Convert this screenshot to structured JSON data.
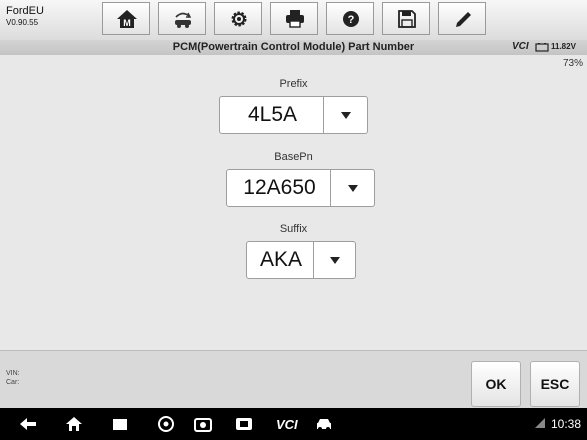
{
  "app": {
    "name": "FordEU",
    "version": "V0.90.55"
  },
  "toolbar": {
    "icons": [
      "home-icon",
      "vehicle-swap-icon",
      "settings-icon",
      "print-icon",
      "help-icon",
      "save-icon",
      "edit-icon"
    ]
  },
  "header": {
    "title": "PCM(Powertrain Control Module) Part Number",
    "vci_label": "VCI",
    "battery": "11.82V"
  },
  "progress": {
    "percent_label": "73%",
    "value": 73
  },
  "fields": {
    "prefix": {
      "label": "Prefix",
      "value": "4L5A"
    },
    "basepn": {
      "label": "BasePn",
      "value": "12A650"
    },
    "suffix": {
      "label": "Suffix",
      "value": "AKA"
    }
  },
  "footer": {
    "vin_label": "VIN:",
    "car_label": "Car:",
    "ok_label": "OK",
    "esc_label": "ESC"
  },
  "navbar": {
    "vcl_label": "VCI",
    "time": "10:38"
  }
}
